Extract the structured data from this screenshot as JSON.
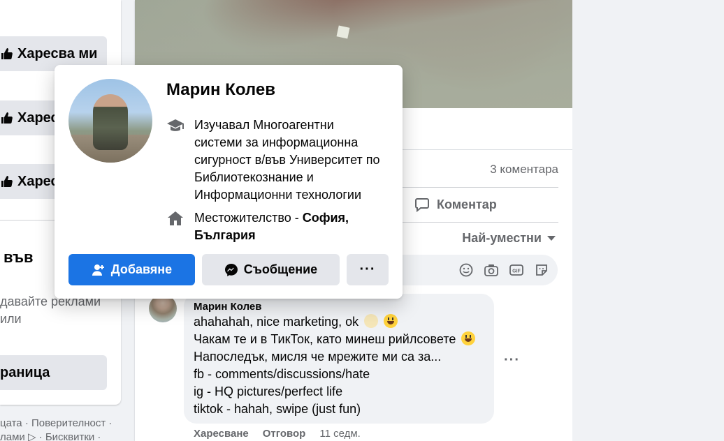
{
  "left": {
    "like_label_1": "Харесва ми",
    "like_label_2": "Харес",
    "like_label_3": "Харес",
    "heading": "във",
    "text_line_1": "давайте реклами",
    "text_line_2": "или",
    "page_button": "раница",
    "footer_line_1": "цата · Поверителност ·",
    "footer_line_2": "лами ▷ · Бисквитки ·"
  },
  "post": {
    "comments_count": "3 коментара",
    "comment_action": "Коментар",
    "sort_label": "Най-уместни",
    "composer_icons": [
      "emoji-icon",
      "camera-icon",
      "gif-icon",
      "sticker-icon"
    ]
  },
  "comment": {
    "author": "Марин Колев",
    "lines": [
      "ahahahah, nice marketing, ok",
      "Чакам те и в ТикТок, като минеш рийлсовете",
      "Напоследък, мисля че мрежите ми са за...",
      "fb - comments/discussions/hate",
      "ig - HQ pictures/perfect life",
      "tiktok - hahah, swipe (just fun)"
    ],
    "more": "···",
    "like": "Харесване",
    "reply": "Отговор",
    "time": "11 седм."
  },
  "hover_card": {
    "name": "Марин Колев",
    "education": "Изучавал Многоагентни системи за информационна сигурност в/във Университет по Библиотекознание и Информационни технологии",
    "residence_prefix": "Местожителство - ",
    "residence_place": "София, България",
    "add_button": "Добавяне",
    "message_button": "Съобщение",
    "more_button": "···"
  },
  "colors": {
    "accent": "#1b74e4",
    "secondary_button": "#e4e6eb",
    "muted_text": "#65676b",
    "background": "#f0f2f5"
  }
}
